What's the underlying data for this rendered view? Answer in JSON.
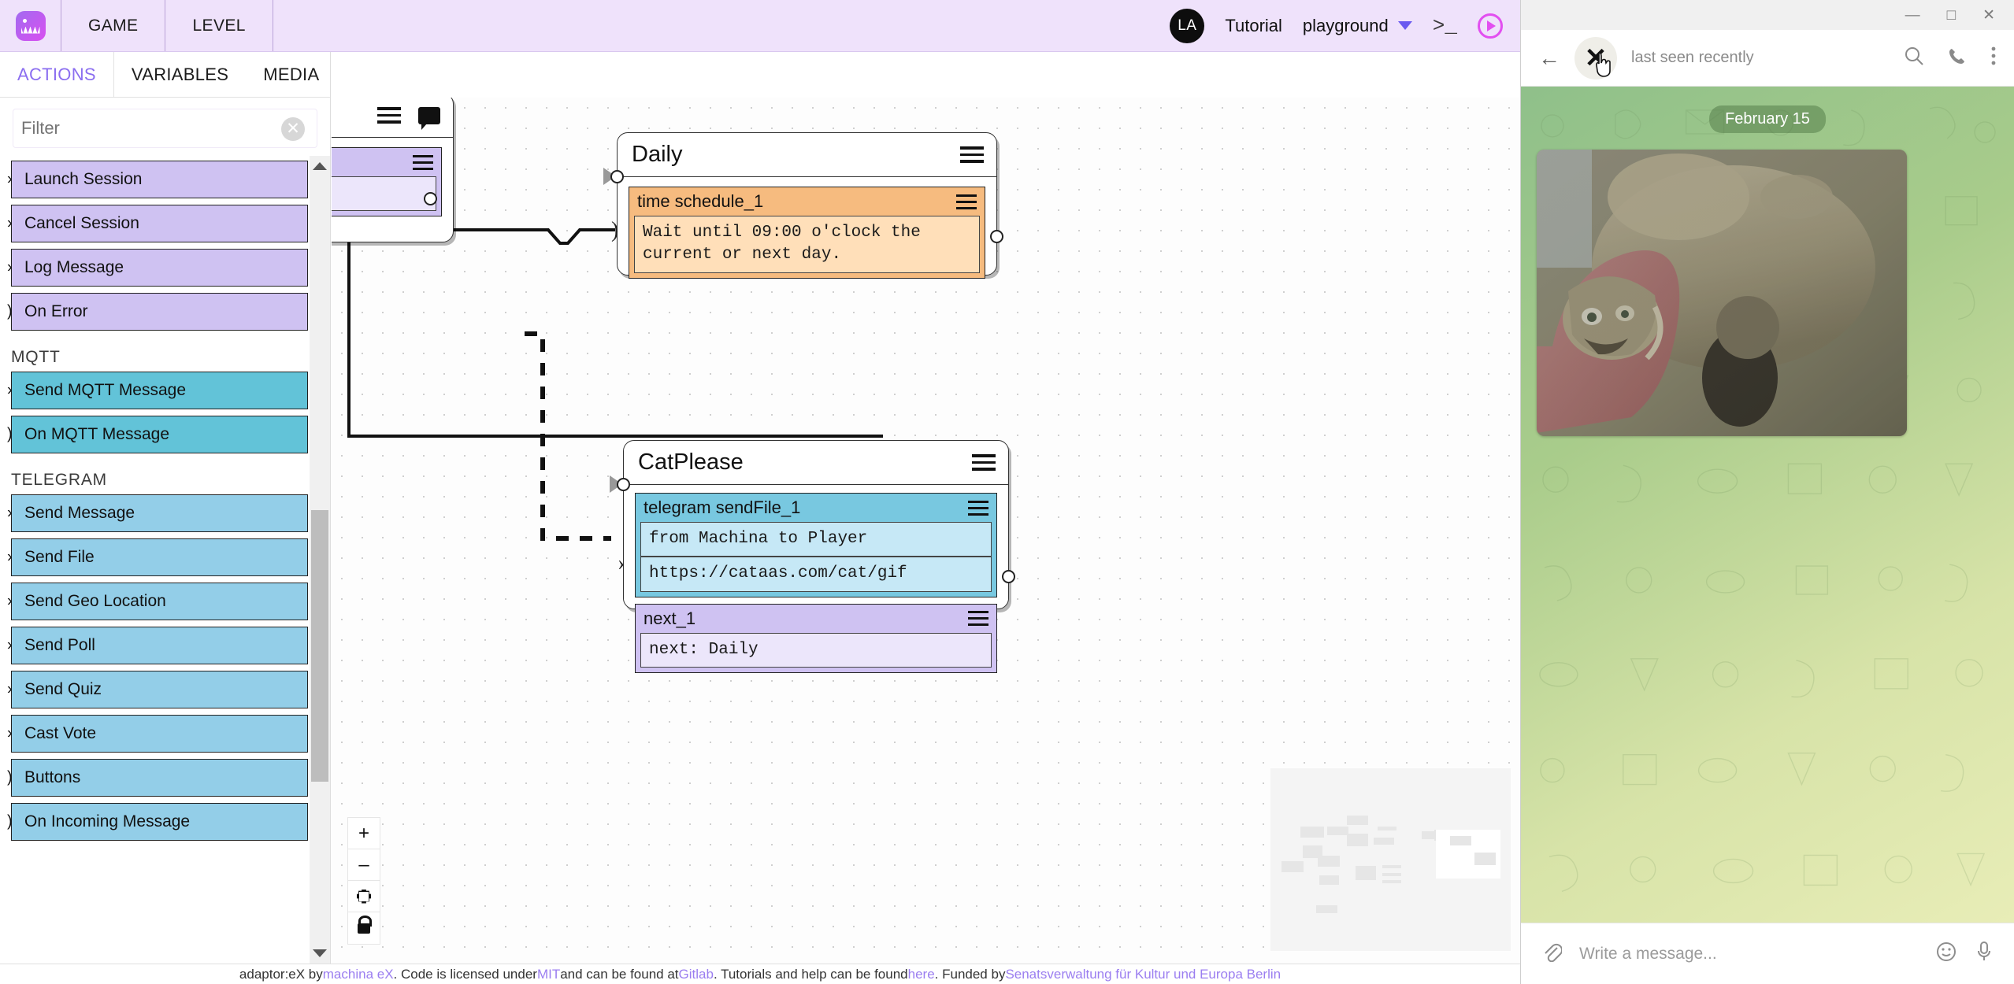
{
  "app": {
    "topbar": {
      "logo_alt": "machina-ex-logo",
      "nav": [
        {
          "label": "GAME"
        },
        {
          "label": "LEVEL"
        }
      ],
      "avatar_initials": "LA",
      "tutorial_label": "Tutorial",
      "project_name": "playground",
      "terminal_icon": ">_",
      "play_icon": "play-circle"
    },
    "panel": {
      "tabs": [
        {
          "label": "ACTIONS",
          "active": true
        },
        {
          "label": "VARIABLES",
          "active": false
        },
        {
          "label": "MEDIA",
          "active": false
        }
      ],
      "filter_placeholder": "Filter",
      "filter_value": "",
      "groups": [
        {
          "label": "",
          "items": [
            {
              "label": "Launch Session",
              "glyph": "›",
              "color": "purple"
            },
            {
              "label": "Cancel Session",
              "glyph": "›",
              "color": "purple"
            },
            {
              "label": "Log Message",
              "glyph": "›",
              "color": "purple"
            },
            {
              "label": "On Error",
              "glyph": ")",
              "color": "purple"
            }
          ]
        },
        {
          "label": "MQTT",
          "items": [
            {
              "label": "Send MQTT Message",
              "glyph": "›",
              "color": "teal"
            },
            {
              "label": "On MQTT Message",
              "glyph": ")",
              "color": "teal"
            }
          ]
        },
        {
          "label": "TELEGRAM",
          "items": [
            {
              "label": "Send Message",
              "glyph": "›",
              "color": "blue"
            },
            {
              "label": "Send File",
              "glyph": "›",
              "color": "blue"
            },
            {
              "label": "Send Geo Location",
              "glyph": "›",
              "color": "blue"
            },
            {
              "label": "Send Poll",
              "glyph": "›",
              "color": "blue"
            },
            {
              "label": "Send Quiz",
              "glyph": "›",
              "color": "blue"
            },
            {
              "label": "Cast Vote",
              "glyph": "›",
              "color": "blue"
            },
            {
              "label": "Buttons",
              "glyph": ")",
              "color": "blue"
            },
            {
              "label": "On Incoming Message",
              "glyph": ")",
              "color": "blue"
            }
          ]
        }
      ]
    },
    "canvas": {
      "nodes": [
        {
          "id": "partial",
          "title": "",
          "blocks": [
            {
              "title": "",
              "rows": [
                ""
              ],
              "color": "purple"
            }
          ]
        },
        {
          "id": "daily",
          "title": "Daily",
          "blocks": [
            {
              "title": "time schedule_1",
              "rows": [
                "Wait until 09:00 o'clock the current or next day."
              ],
              "color": "orange"
            }
          ]
        },
        {
          "id": "catplease",
          "title": "CatPlease",
          "blocks": [
            {
              "title": "telegram sendFile_1",
              "rows": [
                "from Machina to Player",
                "https://cataas.com/cat/gif"
              ],
              "color": "teal"
            },
            {
              "title": "next_1",
              "rows": [
                "next: Daily"
              ],
              "color": "purple"
            }
          ]
        }
      ],
      "zoom_controls": [
        {
          "name": "zoom-in",
          "icon": "+"
        },
        {
          "name": "zoom-out",
          "icon": "–"
        },
        {
          "name": "fit-view",
          "icon": "fit"
        },
        {
          "name": "lock",
          "icon": "lock"
        }
      ]
    },
    "footer": {
      "part1": "adaptor:eX by ",
      "link1": "machina eX",
      "part2": " . Code is licensed under ",
      "link2": "MIT",
      "part3": " and can be found at ",
      "link3": "Gitlab",
      "part4": " . Tutorials and help can be found ",
      "link4": "here",
      "part5": " . Funded by ",
      "link5": "Senatsverwaltung für Kultur und Europa Berlin"
    }
  },
  "telegram": {
    "window_controls": {
      "minimize": "—",
      "maximize": "□",
      "close": "✕"
    },
    "header": {
      "back_icon": "←",
      "avatar_letter": "✕",
      "status": "last seen recently",
      "search_icon": "search-icon",
      "call_icon": "phone-icon",
      "menu_icon": "more-vertical-icon"
    },
    "chat": {
      "date_chip": "February 15",
      "photo_alt": "cat-gif-photo"
    },
    "composer": {
      "attach_icon": "paperclip-icon",
      "placeholder": "Write a message...",
      "emoji_icon": "smiley-icon",
      "mic_icon": "microphone-icon"
    }
  },
  "colors": {
    "brand_purple": "#8b6ef0",
    "topbar_bg": "#efe2fb",
    "action_purple": "#cfc2f2",
    "action_teal": "#62c3d8",
    "action_blue": "#93cee8",
    "block_orange": "#f6bb7f",
    "play_pink": "#e24ff0"
  }
}
